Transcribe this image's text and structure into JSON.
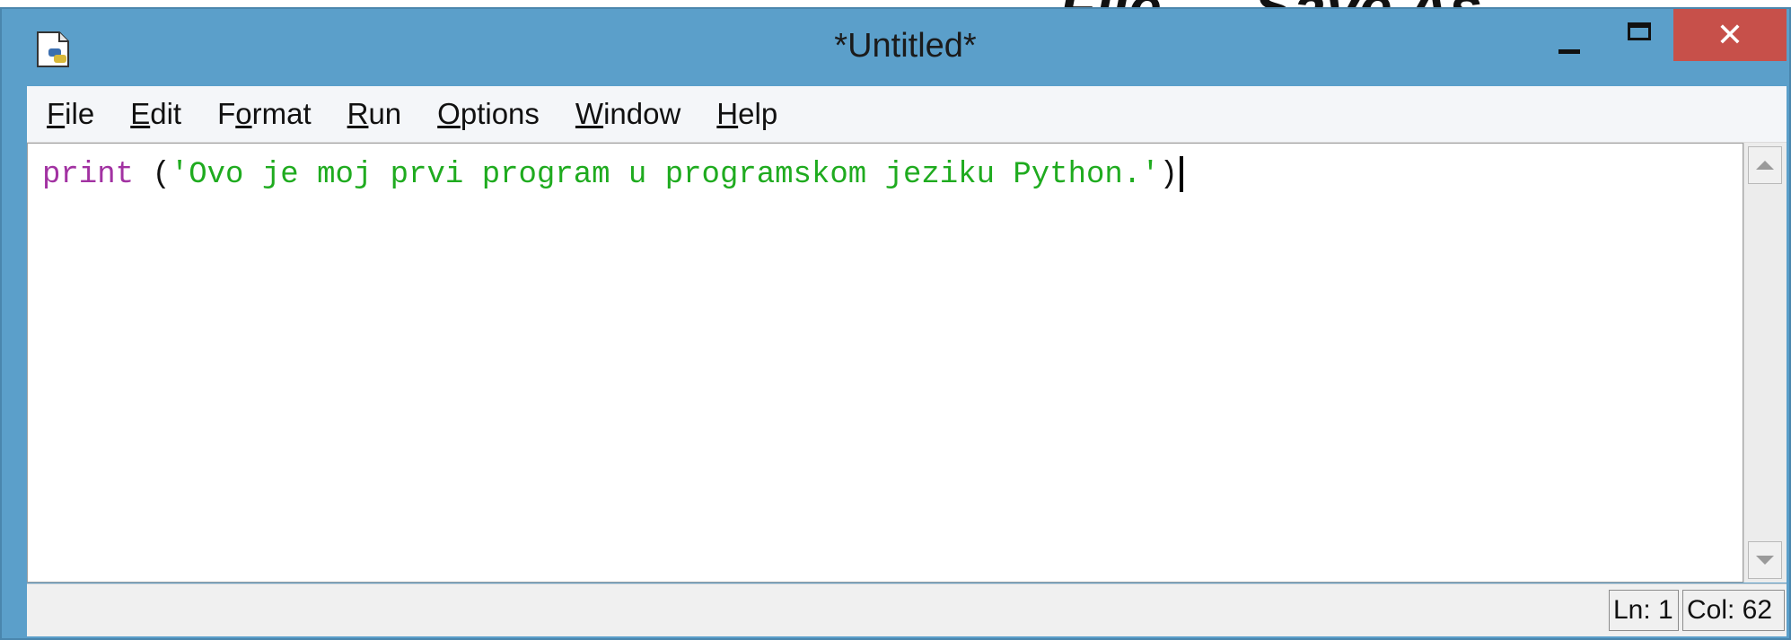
{
  "background": {
    "partial_text": "File → Save As"
  },
  "window": {
    "title": "*Untitled*",
    "close_symbol": "✕",
    "icons": {
      "app": "python-idle-file-icon",
      "minimize": "minimize-icon",
      "maximize": "maximize-icon",
      "close": "close-icon"
    },
    "colors": {
      "titlebar": "#5b9fca",
      "close_button": "#c7504a"
    }
  },
  "menu": {
    "items": [
      {
        "accel": "F",
        "rest": "ile"
      },
      {
        "accel": "E",
        "rest": "dit"
      },
      {
        "pre": "F",
        "accel": "o",
        "rest": "rmat"
      },
      {
        "accel": "R",
        "rest": "un"
      },
      {
        "accel": "O",
        "rest": "ptions"
      },
      {
        "accel": "W",
        "rest": "indow"
      },
      {
        "accel": "H",
        "rest": "elp"
      }
    ]
  },
  "editor": {
    "code": {
      "keyword": "print",
      "space": " ",
      "open_paren": "(",
      "string": "'Ovo je moj prvi program u programskom jeziku Python.'",
      "close_paren": ")"
    },
    "colors": {
      "keyword": "#a232a2",
      "string": "#1fab1f"
    }
  },
  "status": {
    "line": "Ln: 1",
    "col": "Col: 62"
  }
}
